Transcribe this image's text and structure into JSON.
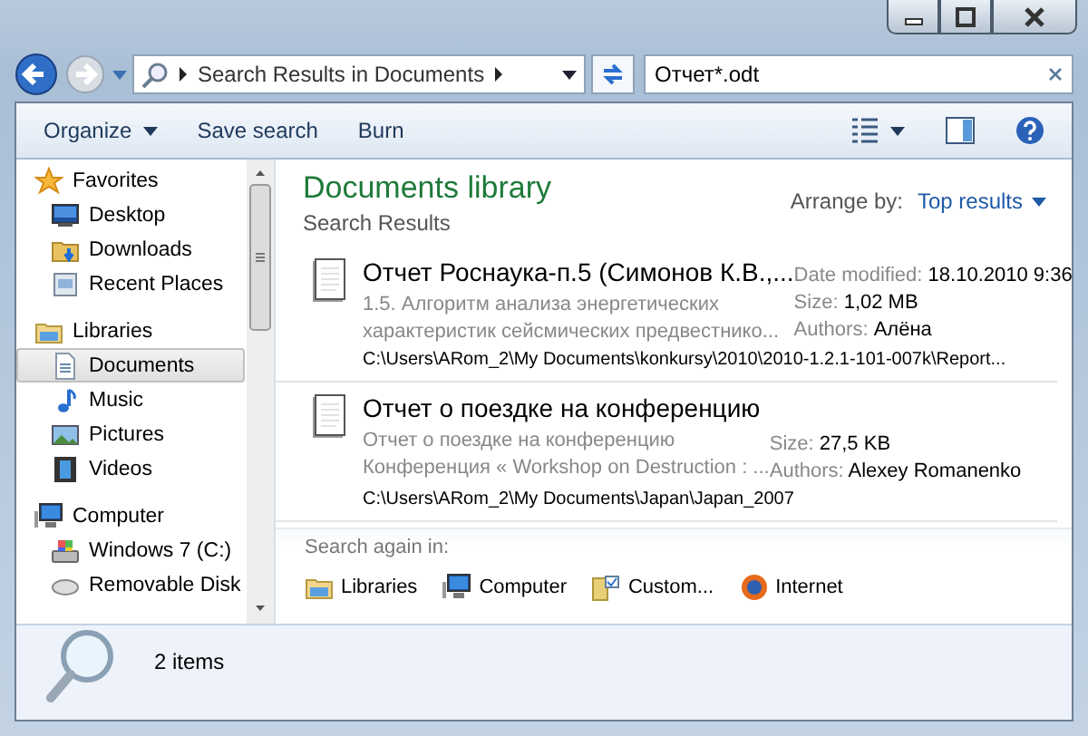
{
  "address": {
    "breadcrumb": "Search Results in Documents"
  },
  "search": {
    "value": "Отчет*.odt"
  },
  "toolbar": {
    "buttons": [
      {
        "label": "Organize",
        "dropdown": true
      },
      {
        "label": "Save search",
        "dropdown": false
      },
      {
        "label": "Burn",
        "dropdown": false
      }
    ]
  },
  "sidebar": {
    "groups": [
      {
        "label": "Favorites",
        "children": [
          {
            "label": "Desktop",
            "selected": false
          },
          {
            "label": "Downloads",
            "selected": false
          },
          {
            "label": "Recent Places",
            "selected": false
          }
        ]
      },
      {
        "label": "Libraries",
        "children": [
          {
            "label": "Documents",
            "selected": true
          },
          {
            "label": "Music",
            "selected": false
          },
          {
            "label": "Pictures",
            "selected": false
          },
          {
            "label": "Videos",
            "selected": false
          }
        ]
      },
      {
        "label": "Computer",
        "children": [
          {
            "label": "Windows 7 (C:)",
            "selected": false
          },
          {
            "label": "Removable Disk",
            "selected": false
          }
        ]
      }
    ]
  },
  "library": {
    "title": "Documents library",
    "subtitle": "Search Results",
    "arrange_label": "Arrange by:",
    "arrange_value": "Top results"
  },
  "results": [
    {
      "name": "Отчет Роснаука-п.5 (Симонов К.В.,...",
      "snippet": [
        "1.5. Алгоритм анализа энергетических",
        "характеристик сейсмических предвестнико..."
      ],
      "path": "C:\\Users\\ARom_2\\My Documents\\konkursy\\2010\\2010-1.2.1-101-007k\\Report...",
      "meta": [
        {
          "label": "Date modified:",
          "value": "18.10.2010 9:36"
        },
        {
          "label": "Size:",
          "value": "1,02 MB"
        },
        {
          "label": "Authors:",
          "value": "Алёна"
        }
      ]
    },
    {
      "name": "Отчет о поездке на конференцию",
      "snippet": [
        "Отчет о поездке на конференцию",
        "Конференция « Workshop on Destruction : ..."
      ],
      "path": "C:\\Users\\ARom_2\\My Documents\\Japan\\Japan_2007",
      "meta": [
        {
          "label": "Size:",
          "value": "27,5 KB"
        },
        {
          "label": "Authors:",
          "value": "Alexey Romanenko"
        }
      ]
    }
  ],
  "search_again": {
    "label": "Search again in:",
    "options": [
      "Libraries",
      "Computer",
      "Custom...",
      "Internet"
    ]
  },
  "status_bar": {
    "count": "2 items"
  }
}
